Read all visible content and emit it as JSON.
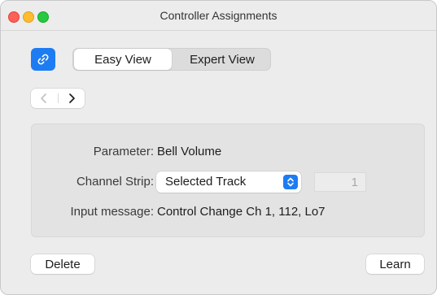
{
  "window": {
    "title": "Controller Assignments"
  },
  "toolbar": {
    "link_icon": "link-icon",
    "accent_color": "#1e7cf2",
    "tabs": [
      {
        "label": "Easy View",
        "selected": true
      },
      {
        "label": "Expert View",
        "selected": false
      }
    ],
    "nav": {
      "back_icon": "chevron-left-icon",
      "forward_icon": "chevron-right-icon",
      "back_enabled": false,
      "forward_enabled": true
    }
  },
  "details": {
    "parameter_label": "Parameter:",
    "parameter_value": "Bell Volume",
    "channel_strip_label": "Channel Strip:",
    "channel_strip_value": "Selected Track",
    "channel_number": "1",
    "input_message_label": "Input message:",
    "input_message_value": "Control Change Ch 1, 112, Lo7"
  },
  "footer": {
    "delete_label": "Delete",
    "learn_label": "Learn"
  }
}
